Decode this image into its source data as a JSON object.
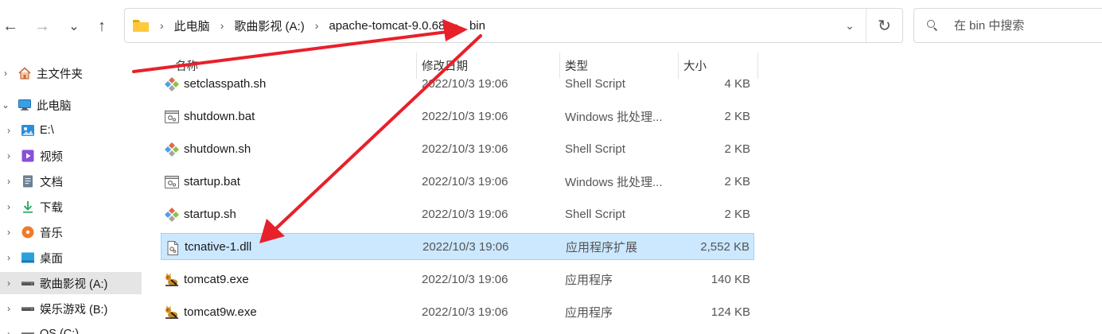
{
  "nav": {
    "back": "←",
    "forward": "→",
    "recent": "⌄",
    "up": "↑"
  },
  "breadcrumb": [
    "此电脑",
    "歌曲影视 (A:)",
    "apache-tomcat-9.0.68",
    "bin"
  ],
  "search": {
    "placeholder": "在 bin 中搜索"
  },
  "sidebar": [
    {
      "label": "主文件夹",
      "icon": "home-icon",
      "expander": "›"
    },
    {
      "label": "此电脑",
      "icon": "pc-icon",
      "expander": "⌄"
    },
    {
      "label": "E:\\",
      "icon": "image-drive-icon",
      "expander": "›"
    },
    {
      "label": "视频",
      "icon": "video-icon",
      "expander": "›"
    },
    {
      "label": "文档",
      "icon": "document-icon",
      "expander": "›"
    },
    {
      "label": "下载",
      "icon": "download-icon",
      "expander": "›"
    },
    {
      "label": "音乐",
      "icon": "music-icon",
      "expander": "›"
    },
    {
      "label": "桌面",
      "icon": "desktop-icon",
      "expander": "›"
    },
    {
      "label": "歌曲影视 (A:)",
      "icon": "drive-icon",
      "expander": "›"
    },
    {
      "label": "娱乐游戏 (B:)",
      "icon": "drive-icon",
      "expander": "›"
    },
    {
      "label": "OS (C:)",
      "icon": "drive-icon",
      "expander": "›"
    }
  ],
  "columns": {
    "name": "名称",
    "date": "修改日期",
    "type": "类型",
    "size": "大小"
  },
  "files": [
    {
      "name": "setclasspath.sh",
      "date": "2022/10/3 19:06",
      "type": "Shell Script",
      "size": "4 KB",
      "icon": "shell-script-icon"
    },
    {
      "name": "shutdown.bat",
      "date": "2022/10/3 19:06",
      "type": "Windows 批处理...",
      "size": "2 KB",
      "icon": "batch-file-icon"
    },
    {
      "name": "shutdown.sh",
      "date": "2022/10/3 19:06",
      "type": "Shell Script",
      "size": "2 KB",
      "icon": "shell-script-icon"
    },
    {
      "name": "startup.bat",
      "date": "2022/10/3 19:06",
      "type": "Windows 批处理...",
      "size": "2 KB",
      "icon": "batch-file-icon"
    },
    {
      "name": "startup.sh",
      "date": "2022/10/3 19:06",
      "type": "Shell Script",
      "size": "2 KB",
      "icon": "shell-script-icon"
    },
    {
      "name": "tcnative-1.dll",
      "date": "2022/10/3 19:06",
      "type": "应用程序扩展",
      "size": "2,552 KB",
      "icon": "dll-file-icon",
      "selected": true
    },
    {
      "name": "tomcat9.exe",
      "date": "2022/10/3 19:06",
      "type": "应用程序",
      "size": "140 KB",
      "icon": "tomcat-exe-icon"
    },
    {
      "name": "tomcat9w.exe",
      "date": "2022/10/3 19:06",
      "type": "应用程序",
      "size": "124 KB",
      "icon": "tomcat-exe-icon"
    }
  ],
  "colors": {
    "selection": "#cce8ff",
    "selection_border": "#99d1ff",
    "annotation_arrow": "#e8202a"
  }
}
